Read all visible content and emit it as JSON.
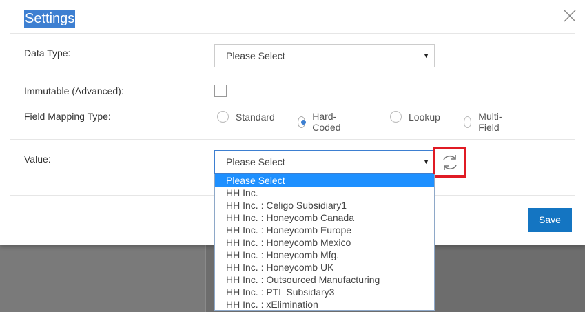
{
  "modal": {
    "title": "Settings",
    "close_icon": "close-icon"
  },
  "fields": {
    "data_type": {
      "label": "Data Type:",
      "value": "Please Select"
    },
    "immutable": {
      "label": "Immutable (Advanced):",
      "checked": false
    },
    "field_mapping_type": {
      "label": "Field Mapping Type:",
      "options": [
        "Standard",
        "Hard-Coded",
        "Lookup",
        "Multi-Field"
      ],
      "selected": "Hard-Coded"
    },
    "value": {
      "label": "Value:",
      "value": "Please Select",
      "refresh_icon": "refresh-icon"
    }
  },
  "dropdown": {
    "options": [
      "Please Select",
      "HH Inc.",
      "HH Inc. : Celigo Subsidiary1",
      "HH Inc. : Honeycomb Canada",
      "HH Inc. : Honeycomb Europe",
      "HH Inc. : Honeycomb Mexico",
      "HH Inc. : Honeycomb Mfg.",
      "HH Inc. : Honeycomb UK",
      "HH Inc. : Outsourced Manufacturing",
      "HH Inc. : PTL Subsidary3",
      "HH Inc. : xElimination"
    ],
    "highlighted": "Please Select"
  },
  "actions": {
    "save_label": "Save"
  },
  "colors": {
    "accent": "#1475c2",
    "highlight": "#1e90ff",
    "annotation_box": "#e01b24"
  }
}
